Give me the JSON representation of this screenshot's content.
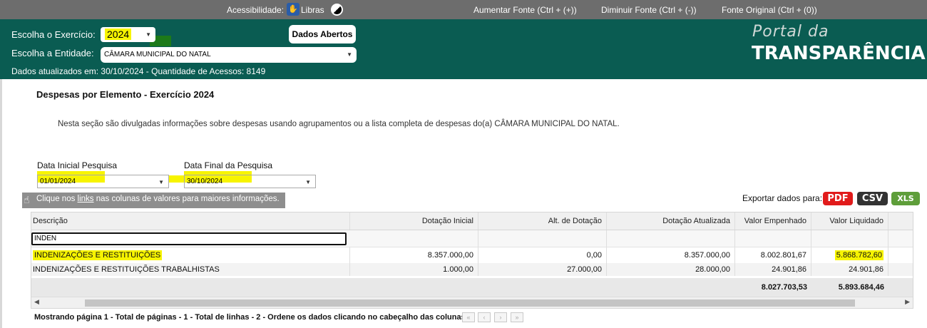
{
  "topbar": {
    "acessibilidade": "Acessibilidade:",
    "libras": "Libras",
    "aumentar": "Aumentar Fonte (Ctrl + (+))",
    "diminuir": "Diminuir Fonte (Ctrl + (-))",
    "original": "Fonte Original (Ctrl + (0))"
  },
  "header": {
    "exercicio_label": "Escolha o Exercício:",
    "exercicio_value": "2024",
    "entidade_label": "Escolha a Entidade:",
    "entidade_value": "CÂMARA MUNICIPAL DO NATAL",
    "dados_abertos": "Dados Abertos",
    "updated": "Dados atualizados em: 30/10/2024 - Quantidade de Acessos: 8149",
    "logo_top": "Portal da",
    "logo_bottom": "TRANSPARÊNCIA"
  },
  "content": {
    "title": "Despesas por Elemento - Exercício 2024",
    "description": "Nesta seção são divulgadas informações sobre despesas usando agrupamentos ou a lista completa de despesas do(a) CÂMARA MUNICIPAL DO NATAL.",
    "data_inicial_label": "Data Inicial Pesquisa",
    "data_inicial_value": "01/01/2024",
    "data_final_label": "Data Final da Pesquisa",
    "data_final_value": "30/10/2024",
    "hint_pre": "Clique nos ",
    "hint_link": "links",
    "hint_post": " nas colunas de valores para maiores informações.",
    "export_label": "Exportar dados para:",
    "export_pdf": "PDF",
    "export_csv": "CSV",
    "export_xls": "XLS"
  },
  "table": {
    "columns": [
      "Descrição",
      "Dotação Inicial",
      "Alt. de Dotação",
      "Dotação Atualizada",
      "Valor Empenhado",
      "Valor Liquidado"
    ],
    "filter_value": "INDEN",
    "rows": [
      [
        "INDENIZAÇÕES E RESTITUIÇÕES",
        "8.357.000,00",
        "0,00",
        "8.357.000,00",
        "8.002.801,67",
        "5.868.782,60"
      ],
      [
        "INDENIZAÇÕES E RESTITUIÇÕES TRABALHISTAS",
        "1.000,00",
        "27.000,00",
        "28.000,00",
        "24.901,86",
        "24.901,86"
      ]
    ],
    "totals": {
      "valor_empenhado": "8.027.703,53",
      "valor_liquidado": "5.893.684,46"
    },
    "footer": "Mostrando página 1 - Total de páginas - 1 - Total de linhas - 2 - Ordene os dados clicando no cabeçalho das colunas.",
    "pager": [
      "«",
      "‹",
      "›",
      "»"
    ]
  },
  "colors": {
    "header_bg": "#0a5c52",
    "topbar_bg": "#6d6d6d",
    "highlight": "#f7f400",
    "pdf": "#e11b1b",
    "csv": "#333333",
    "xls": "#5e9e3a"
  }
}
